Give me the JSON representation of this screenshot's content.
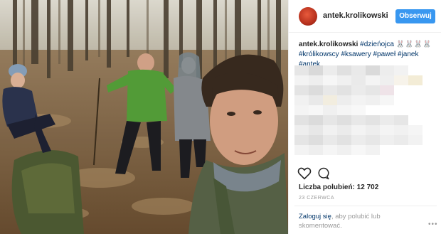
{
  "post": {
    "username": "antek.krolikowski",
    "follow_label": "Obserwuj",
    "caption_user": "antek.krolikowski",
    "caption_tags": [
      "#dzieńojca",
      "#królikowscy",
      "#ksawery",
      "#paweł",
      "#janek",
      "#antek"
    ],
    "caption_emoji": "🐰🐰🐰🐰",
    "likes_text": "Liczba polubień: 12 702",
    "date": "23 CZERWCA",
    "login_link": "Zaloguj się",
    "login_rest": ", aby polubić lub skomentować.",
    "more_label": "•••"
  },
  "icons": {
    "like": "heart-icon",
    "comment": "comment-icon",
    "more": "more-options-icon"
  },
  "colors": {
    "follow_button": "#3897f0",
    "link": "#003569",
    "muted": "#999999",
    "avatar": "#c23a24"
  }
}
